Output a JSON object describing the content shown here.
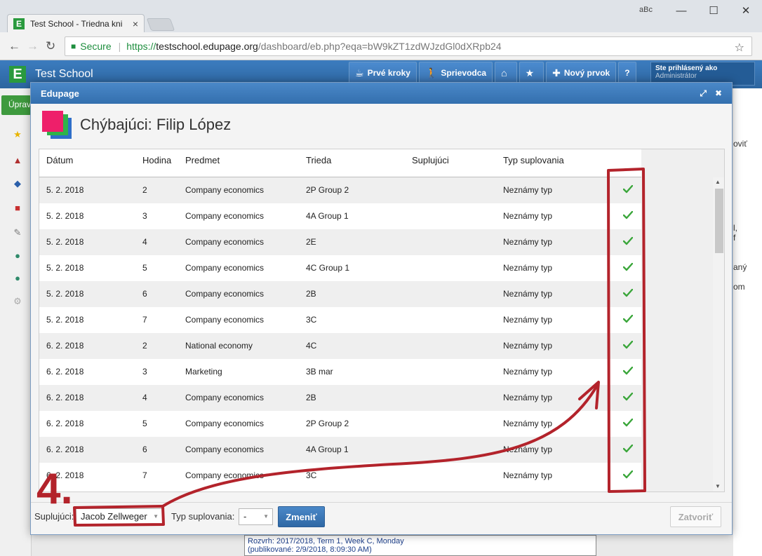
{
  "browser": {
    "tab_title": "Test School - Triedna kni",
    "tab_close": "×",
    "favicon_letter": "E",
    "user_indicator": "aBc",
    "window_controls": [
      "—",
      "☐",
      "✕"
    ],
    "secure_label": "Secure",
    "url_scheme": "https://",
    "url_host": "testschool.edupage.org",
    "url_path": "/dashboard/eb.php?eqa=bW9kZT1zdWJzdGl0dXRpb24"
  },
  "app": {
    "logo_letter": "E",
    "title": "Test School",
    "menu": [
      {
        "label": "Prvé kroky",
        "icon": "coffee-icon"
      },
      {
        "label": "Sprievodca",
        "icon": "walker-icon"
      },
      {
        "label": "",
        "icon": "home-icon"
      },
      {
        "label": "",
        "icon": "star-icon"
      },
      {
        "label": "Nový prvok",
        "icon": "plus-icon"
      },
      {
        "label": "?",
        "icon": "help-icon"
      }
    ],
    "logged_in_label": "Ste prihlásený ako",
    "logged_in_user": "Administrátor",
    "left_button": "Úprav",
    "right_fragments": [
      "oviť",
      "l,",
      "f",
      "aný",
      "om"
    ]
  },
  "bottom_info": {
    "line1": "Rozvrh: 2017/2018, Term 1, Week C, Monday",
    "line2": "(publikované: 2/9/2018, 8:09:30 AM)"
  },
  "modal": {
    "title": "Edupage",
    "heading": "Chýbajúci: Filip López",
    "columns": [
      "Dátum",
      "Hodina",
      "Predmet",
      "Trieda",
      "Suplujúci",
      "Typ suplovania"
    ],
    "rows": [
      {
        "date": "5. 2. 2018",
        "hour": "2",
        "subject": "Company economics",
        "class": "2P Group 2",
        "sub": "",
        "type": "Neznámy typ"
      },
      {
        "date": "5. 2. 2018",
        "hour": "3",
        "subject": "Company economics",
        "class": "4A Group 1",
        "sub": "",
        "type": "Neznámy typ"
      },
      {
        "date": "5. 2. 2018",
        "hour": "4",
        "subject": "Company economics",
        "class": "2E",
        "sub": "",
        "type": "Neznámy typ"
      },
      {
        "date": "5. 2. 2018",
        "hour": "5",
        "subject": "Company economics",
        "class": "4C Group 1",
        "sub": "",
        "type": "Neznámy typ"
      },
      {
        "date": "5. 2. 2018",
        "hour": "6",
        "subject": "Company economics",
        "class": "2B",
        "sub": "",
        "type": "Neznámy typ"
      },
      {
        "date": "5. 2. 2018",
        "hour": "7",
        "subject": "Company economics",
        "class": "3C",
        "sub": "",
        "type": "Neznámy typ"
      },
      {
        "date": "6. 2. 2018",
        "hour": "2",
        "subject": "National economy",
        "class": "4C",
        "sub": "",
        "type": "Neznámy typ"
      },
      {
        "date": "6. 2. 2018",
        "hour": "3",
        "subject": "Marketing",
        "class": "3B mar",
        "sub": "",
        "type": "Neznámy typ"
      },
      {
        "date": "6. 2. 2018",
        "hour": "4",
        "subject": "Company economics",
        "class": "2B",
        "sub": "",
        "type": "Neznámy typ"
      },
      {
        "date": "6. 2. 2018",
        "hour": "5",
        "subject": "Company economics",
        "class": "2P Group 2",
        "sub": "",
        "type": "Neznámy typ"
      },
      {
        "date": "6. 2. 2018",
        "hour": "6",
        "subject": "Company economics",
        "class": "4A Group 1",
        "sub": "",
        "type": "Neznámy typ"
      },
      {
        "date": "6. 2. 2018",
        "hour": "7",
        "subject": "Company economics",
        "class": "3C",
        "sub": "",
        "type": "Neznámy typ"
      }
    ],
    "footer": {
      "substitute_label": "Suplujúci:",
      "substitute_value": "Jacob Zellweger",
      "type_label": "Typ suplovania:",
      "type_value": "-",
      "change_button": "Zmeniť",
      "close_button": "Zatvoriť"
    }
  },
  "annotation": {
    "step_number": "4.",
    "color": "#b3232b"
  },
  "colors": {
    "header_blue": "#3c7cbf",
    "check_green": "#3aa63a",
    "person_pink": "#ee1f6a",
    "person_green": "#2fb34a",
    "person_blue": "#2f6fc9"
  }
}
